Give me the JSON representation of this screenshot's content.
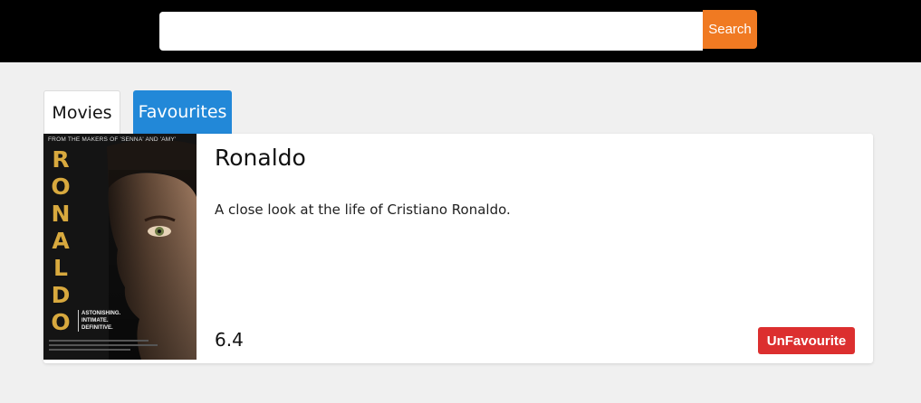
{
  "header": {
    "search_placeholder": "",
    "search_value": "",
    "search_button_label": "Search"
  },
  "tabs": {
    "movies_label": "Movies",
    "favourites_label": "Favourites",
    "active": "favourites"
  },
  "movie": {
    "title": "Ronaldo",
    "description": "A close look at the life of Cristiano Ronaldo.",
    "rating": "6.4",
    "unfavourite_label": "UnFavourite",
    "poster": {
      "tagline": "FROM THE MAKERS OF 'SENNA' AND 'AMY'",
      "title_letters": [
        "R",
        "O",
        "N",
        "A",
        "L",
        "D",
        "O"
      ],
      "subtext": [
        "ASTONISHING.",
        "INTIMATE.",
        "DEFINITIVE."
      ]
    }
  },
  "colors": {
    "topbar": "#000000",
    "search_button": "#f07a22",
    "active_tab": "#2288d8",
    "unfavourite_button": "#dc2f2f",
    "page_background": "#f0f0f0"
  }
}
